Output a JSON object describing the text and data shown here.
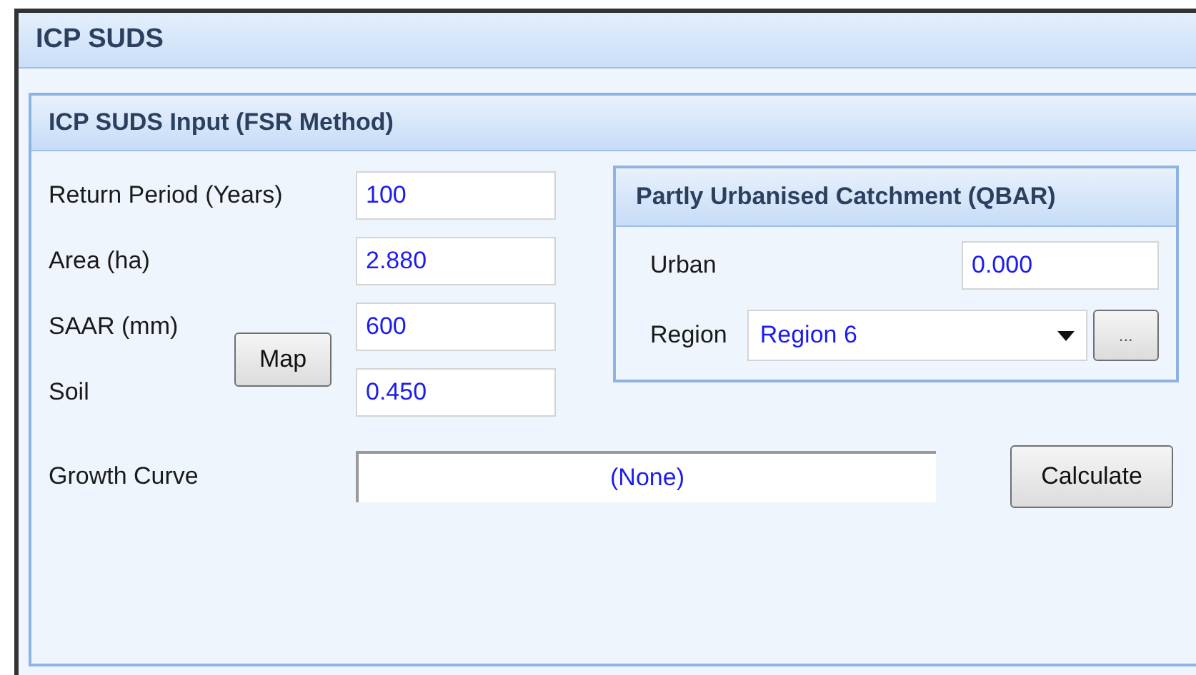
{
  "window": {
    "title": "ICP SUDS"
  },
  "panel": {
    "title": "ICP SUDS Input (FSR Method)",
    "fields": [
      {
        "label": "Return Period (Years)",
        "value": "100"
      },
      {
        "label": "Area (ha)",
        "value": "2.880"
      },
      {
        "label": "SAAR (mm)",
        "value": "600"
      },
      {
        "label": "Soil",
        "value": "0.450"
      }
    ],
    "map_button": "Map",
    "catchment": {
      "title": "Partly Urbanised Catchment (QBAR)",
      "urban_label": "Urban",
      "urban_value": "0.000",
      "region_label": "Region",
      "region_value": "Region 6",
      "browse_button": "..."
    },
    "growth_curve": {
      "label": "Growth Curve",
      "value": "(None)"
    },
    "calculate_button": "Calculate"
  }
}
